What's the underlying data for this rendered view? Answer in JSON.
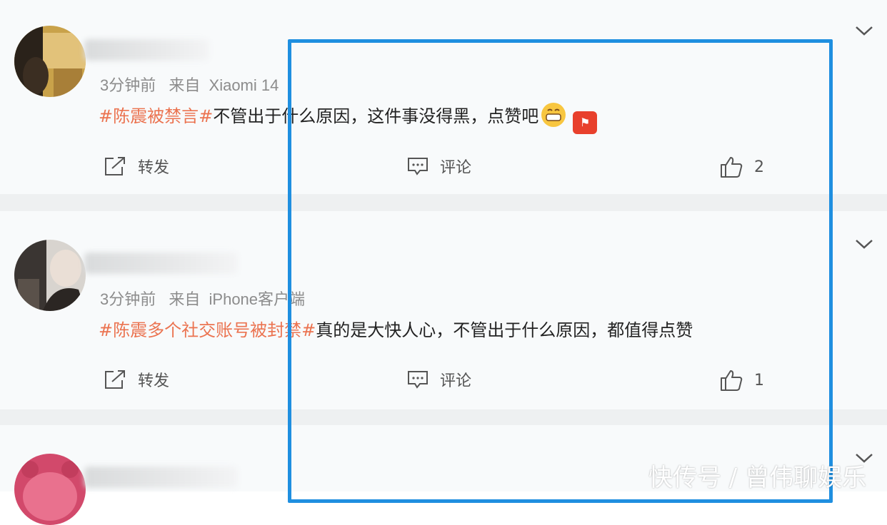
{
  "posts": [
    {
      "time": "3分钟前",
      "source_prefix": "来自",
      "source": "Xiaomi 14",
      "topic": "#陈震被禁言#",
      "text": "不管出于什么原因，这件事没得黑，点赞吧",
      "emoji_icons": [
        "grinning-face-icon",
        "activity-badge-icon"
      ],
      "repost_label": "转发",
      "comment_label": "评论",
      "like_count": "2"
    },
    {
      "time": "3分钟前",
      "source_prefix": "来自",
      "source": "iPhone客户端",
      "topic": "#陈震多个社交账号被封禁#",
      "text": "真的是大快人心，不管出于什么原因，都值得点赞",
      "repost_label": "转发",
      "comment_label": "评论",
      "like_count": "1"
    },
    {}
  ],
  "watermark": "快传号 / 曾伟聊娱乐",
  "colors": {
    "topic": "#eb7350",
    "highlight_border": "#1f8fe0",
    "meta_text": "#8c8c8c"
  }
}
